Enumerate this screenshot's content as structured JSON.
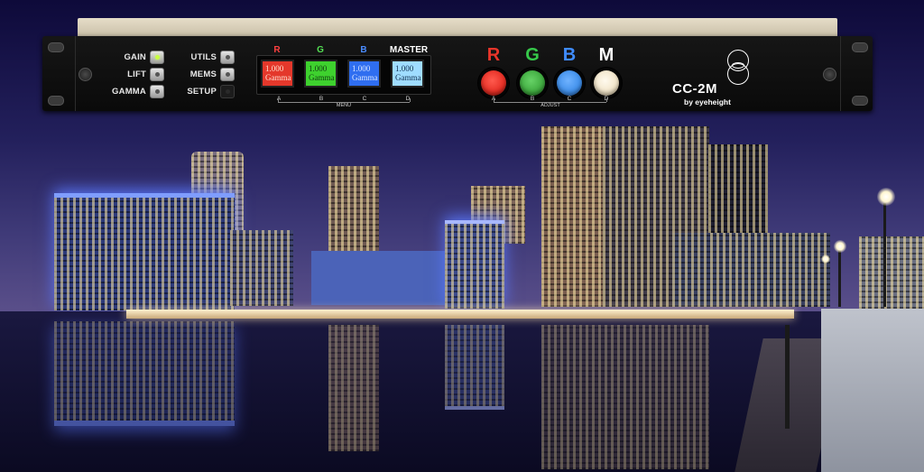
{
  "panel": {
    "left_column": [
      {
        "label": "GAIN",
        "lit": true
      },
      {
        "label": "LIFT",
        "lit": false
      },
      {
        "label": "GAMMA",
        "lit": false
      }
    ],
    "right_column": [
      {
        "label": "UTILS"
      },
      {
        "label": "MEMS"
      },
      {
        "label": "SETUP"
      }
    ],
    "displays": [
      {
        "header": "R",
        "header_color": "#ff4040",
        "bg": "#e4382b",
        "text_color": "#ffe0d0",
        "line1": "1.000",
        "line2": "Gamma",
        "footer": "A"
      },
      {
        "header": "G",
        "header_color": "#54e054",
        "bg": "#3ed12e",
        "text_color": "#103b10",
        "line1": "1.000",
        "line2": "Gamma",
        "footer": "B"
      },
      {
        "header": "B",
        "header_color": "#4a8cff",
        "bg": "#2f6ef0",
        "text_color": "#d8e6ff",
        "line1": "1.000",
        "line2": "Gamma",
        "footer": "C"
      },
      {
        "header": "MASTER",
        "header_color": "#ffffff",
        "bg": "#9fdcff",
        "text_color": "#103050",
        "line1": "1.000",
        "line2": "Gamma",
        "footer": "D"
      }
    ],
    "menu_label": "MENU",
    "knobs": [
      {
        "letter": "R",
        "letter_color": "#e8352a",
        "knob_color": "#e52e24",
        "footer": "A"
      },
      {
        "letter": "G",
        "letter_color": "#36c84a",
        "knob_color": "#3faa3f",
        "footer": "B"
      },
      {
        "letter": "B",
        "letter_color": "#3f8cff",
        "knob_color": "#3f8fea",
        "footer": "C"
      },
      {
        "letter": "M",
        "letter_color": "#ffffff",
        "knob_color": "#f1e4c8",
        "footer": "D"
      }
    ],
    "adjust_label": "ADJUST",
    "brand": "CC-2M",
    "byline": "by eyeheight"
  }
}
